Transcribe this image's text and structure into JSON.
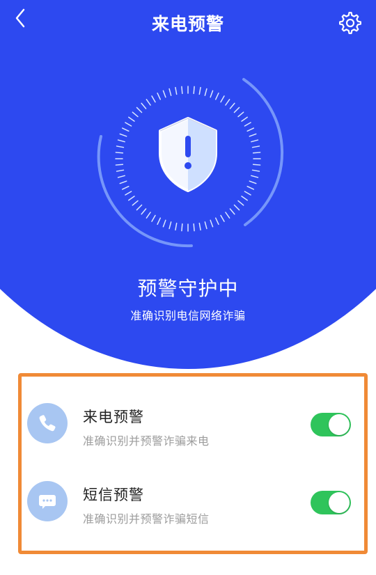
{
  "header": {
    "title": "来电预警",
    "back_icon": "chevron-left-icon",
    "settings_icon": "gear-icon"
  },
  "hero": {
    "status_title": "预警守护中",
    "status_subtitle": "准确识别电信网络诈骗",
    "shield_icon": "shield-alert-icon",
    "colors": {
      "background": "#2d49f0",
      "text": "#ffffff"
    }
  },
  "settings": [
    {
      "title": "来电预警",
      "description": "准确识别并预警诈骗来电",
      "icon": "phone-icon",
      "enabled": true
    },
    {
      "title": "短信预警",
      "description": "准确识别并预警诈骗短信",
      "icon": "message-icon",
      "enabled": true
    }
  ],
  "colors": {
    "toggle_on": "#2fc45b",
    "highlight_border": "#f08a36",
    "icon_circle": "#a8c6f2"
  }
}
